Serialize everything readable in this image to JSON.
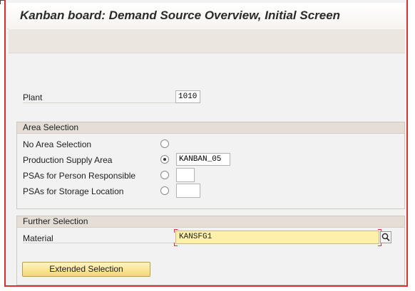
{
  "screen": {
    "title": "Kanban board: Demand Source Overview, Initial Screen"
  },
  "plant": {
    "label": "Plant",
    "value": "1010"
  },
  "area_selection": {
    "header": "Area Selection",
    "options": [
      {
        "label": "No Area Selection",
        "selected": false,
        "value": null
      },
      {
        "label": "Production Supply Area",
        "selected": true,
        "value": "KANBAN_05"
      },
      {
        "label": "PSAs for Person Responsible",
        "selected": false,
        "value": ""
      },
      {
        "label": "PSAs for Storage Location",
        "selected": false,
        "value": ""
      }
    ]
  },
  "further_selection": {
    "header": "Further Selection",
    "material_label": "Material",
    "material_value": "KANSFG1",
    "search_icon": "search-icon"
  },
  "buttons": {
    "extended_selection": "Extended Selection"
  },
  "colors": {
    "frame_red": "#d9302c",
    "required_field_yellow": "#fdf0a8",
    "button_gold": "#f6d873"
  }
}
